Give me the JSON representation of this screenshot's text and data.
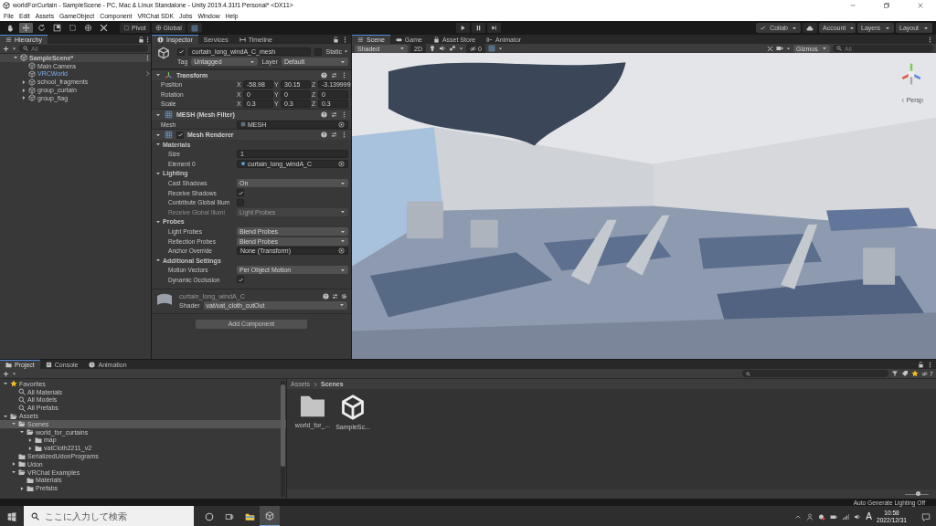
{
  "window": {
    "title": "worldForCurtain - SampleScene - PC, Mac & Linux Standalone - Unity 2019.4.31f1 Personal* <DX11>"
  },
  "menu": [
    "File",
    "Edit",
    "Assets",
    "GameObject",
    "Component",
    "VRChat SDK",
    "Jobs",
    "Window",
    "Help"
  ],
  "toolbar": {
    "tools": [
      {
        "selected": false
      },
      {
        "selected": true
      },
      {
        "selected": false
      },
      {
        "selected": false
      },
      {
        "selected": false
      },
      {
        "selected": false
      },
      {
        "selected": false
      }
    ],
    "pivot": "Pivot",
    "global": "Global",
    "collab": "Collab",
    "account": "Account",
    "layers": "Layers",
    "layout": "Layout"
  },
  "hierarchy": {
    "tab": "Hierarchy",
    "search_placeholder": "All",
    "tree": [
      {
        "label": "SampleScene*",
        "kind": "scene",
        "expanded": true,
        "selected": false,
        "children": [
          {
            "label": "Main Camera",
            "kind": "object",
            "selected": false
          },
          {
            "label": "VRCWorld",
            "kind": "prefab",
            "selected": false
          },
          {
            "label": "school_fragments",
            "kind": "object",
            "expanded": false,
            "selected": false
          },
          {
            "label": "group_curtain",
            "kind": "object",
            "expanded": false,
            "selected": false
          },
          {
            "label": "group_flag",
            "kind": "object",
            "expanded": false,
            "selected": false
          }
        ]
      }
    ]
  },
  "inspector": {
    "tabs": [
      {
        "label": "Inspector",
        "selected": true
      },
      {
        "label": "Services",
        "selected": false
      },
      {
        "label": "Timeline",
        "selected": false
      }
    ],
    "object": {
      "active": true,
      "name": "curtain_long_windA_C_mesh",
      "static_label": "Static",
      "static": false,
      "tag_label": "Tag",
      "tag": "Untagged",
      "layer_label": "Layer",
      "layer": "Default"
    },
    "components": [
      {
        "kind": "transform",
        "title": "Transform",
        "rows": [
          {
            "label": "Position",
            "kind": "vector3",
            "values": [
              {
                "axis": "X",
                "value": "-58.98"
              },
              {
                "axis": "Y",
                "value": "30.15"
              },
              {
                "axis": "Z",
                "value": "-3.139999"
              }
            ]
          },
          {
            "label": "Rotation",
            "kind": "vector3",
            "values": [
              {
                "axis": "X",
                "value": "0"
              },
              {
                "axis": "Y",
                "value": "0"
              },
              {
                "axis": "Z",
                "value": "0"
              }
            ]
          },
          {
            "label": "Scale",
            "kind": "vector3",
            "values": [
              {
                "axis": "X",
                "value": "0.3"
              },
              {
                "axis": "Y",
                "value": "0.3"
              },
              {
                "axis": "Z",
                "value": "0.3"
              }
            ]
          }
        ]
      },
      {
        "kind": "mesh_filter",
        "title": "MESH (Mesh Filter)",
        "rows": [
          {
            "label": "Mesh",
            "kind": "object",
            "value": "MESH"
          }
        ]
      },
      {
        "kind": "mesh_renderer",
        "title": "Mesh Renderer",
        "enabled": true,
        "sections": [
          {
            "label": "Materials",
            "expanded": true,
            "rows": [
              {
                "label": "Size",
                "kind": "number",
                "value": "1"
              },
              {
                "label": "Element 0",
                "kind": "object",
                "value": "curtain_long_windA_C"
              }
            ]
          },
          {
            "label": "Lighting",
            "expanded": true,
            "rows": [
              {
                "label": "Cast Shadows",
                "kind": "dropdown",
                "value": "On",
                "disabled": false
              },
              {
                "label": "Receive Shadows",
                "kind": "check",
                "checked": true
              },
              {
                "label": "Contribute Global Illum",
                "kind": "check",
                "checked": false
              },
              {
                "label": "Receive Global Illumi",
                "kind": "dropdown",
                "value": "Light Probes",
                "disabled": true
              }
            ]
          },
          {
            "label": "Probes",
            "expanded": true,
            "rows": [
              {
                "label": "Light Probes",
                "kind": "dropdown",
                "value": "Blend Probes",
                "disabled": false
              },
              {
                "label": "Reflection Probes",
                "kind": "dropdown",
                "value": "Blend Probes",
                "disabled": false
              },
              {
                "label": "Anchor Override",
                "kind": "object",
                "value": "None (Transform)"
              }
            ]
          },
          {
            "label": "Additional Settings",
            "expanded": true,
            "rows": [
              {
                "label": "Motion Vectors",
                "kind": "dropdown",
                "value": "Per Object Motion",
                "disabled": false
              },
              {
                "label": "Dynamic Occlusion",
                "kind": "check",
                "checked": true
              }
            ]
          }
        ]
      }
    ],
    "material": {
      "name": "curtain_long_windA_C",
      "shader_label": "Shader",
      "shader": "vat/vat_cloth_cutOut"
    },
    "add_button": "Add Component"
  },
  "scene": {
    "tabs": [
      {
        "label": "Scene",
        "selected": true
      },
      {
        "label": "Game",
        "selected": false
      },
      {
        "label": "Asset Store",
        "selected": false
      },
      {
        "label": "Animator",
        "selected": false
      }
    ],
    "shading": "Shaded",
    "mode_2d": "2D",
    "hidden_count": "0",
    "gizmos": "Gizmos",
    "search_placeholder": "All",
    "camera_label": "Persp"
  },
  "project": {
    "tabs": [
      {
        "label": "Project",
        "selected": true
      },
      {
        "label": "Console",
        "selected": false
      },
      {
        "label": "Animation",
        "selected": false
      }
    ],
    "tree": [
      {
        "label": "Favorites",
        "kind": "favorites",
        "expanded": true,
        "selected": false,
        "children": [
          {
            "label": "All Materials",
            "kind": "search",
            "selected": false
          },
          {
            "label": "All Models",
            "kind": "search",
            "selected": false
          },
          {
            "label": "All Prefabs",
            "kind": "search",
            "selected": false
          }
        ]
      },
      {
        "label": "Assets",
        "kind": "folder_open",
        "expanded": true,
        "selected": false,
        "children": [
          {
            "label": "Scenes",
            "kind": "folder_open",
            "expanded": true,
            "selected": true,
            "children": [
              {
                "label": "world_for_curtains",
                "kind": "folder_open",
                "expanded": true,
                "selected": false,
                "children": [
                  {
                    "label": "map",
                    "kind": "folder",
                    "expanded": false,
                    "selected": false
                  },
                  {
                    "label": "vatCloth2211_v2",
                    "kind": "folder",
                    "expanded": false,
                    "selected": false
                  }
                ]
              }
            ]
          },
          {
            "label": "SerializedUdonPrograms",
            "kind": "folder",
            "selected": false
          },
          {
            "label": "Udon",
            "kind": "folder",
            "expanded": false,
            "selected": false
          },
          {
            "label": "VRChat Examples",
            "kind": "folder_open",
            "expanded": true,
            "selected": false,
            "children": [
              {
                "label": "Materials",
                "kind": "folder",
                "selected": false
              },
              {
                "label": "Prefabs",
                "kind": "folder",
                "expanded": false,
                "selected": false
              }
            ]
          }
        ]
      }
    ],
    "hidden_count": "7",
    "breadcrumb": [
      "Assets",
      "Scenes"
    ],
    "items": [
      {
        "label": "world_for_...",
        "kind": "folder"
      },
      {
        "label": "SampleSc...",
        "kind": "scene"
      }
    ],
    "icon_size": {
      "level": 0.55
    }
  },
  "status": "Auto Generate Lighting Off",
  "taskbar": {
    "search_placeholder": "ここに入力して検索",
    "ime": "A",
    "time": "10:58",
    "date": "2022/12/31"
  }
}
